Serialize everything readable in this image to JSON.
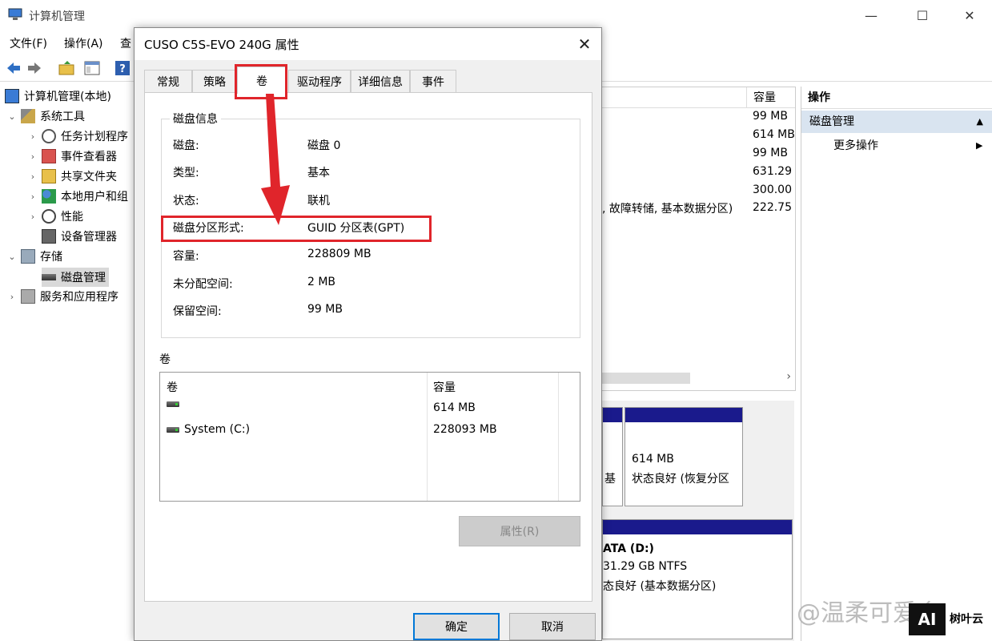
{
  "window": {
    "title": "计算机管理"
  },
  "menu": [
    "文件(F)",
    "操作(A)",
    "查"
  ],
  "tree": {
    "root": "计算机管理(本地)",
    "system_tools": "系统工具",
    "task_scheduler": "任务计划程序",
    "event_viewer": "事件查看器",
    "shared_folders": "共享文件夹",
    "local_users": "本地用户和组",
    "performance": "性能",
    "device_manager": "设备管理器",
    "storage": "存储",
    "disk_management": "磁盘管理",
    "services_apps": "服务和应用程序"
  },
  "list": {
    "capacity_header": "容量",
    "capacities": [
      "99 MB",
      "614 MB",
      "99 MB",
      "631.29",
      "300.00",
      "222.75"
    ],
    "partial_row_text": ", 故障转储, 基本数据分区)"
  },
  "graph": {
    "part1_label": "基",
    "part2_size": "614 MB",
    "part2_status": "状态良好 (恢复分区",
    "drive_d_name": "ATA  (D:)",
    "drive_d_size": "31.29 GB NTFS",
    "drive_d_status": "态良好 (基本数据分区)"
  },
  "actions": {
    "header": "操作",
    "selected": "磁盘管理",
    "more": "更多操作"
  },
  "dialog": {
    "title": "CUSO C5S-EVO 240G 属性",
    "tabs": [
      "常规",
      "策略",
      "卷",
      "驱动程序",
      "详细信息",
      "事件"
    ],
    "active_tab": "卷",
    "disk_info_title": "磁盘信息",
    "disk_info": [
      {
        "label": "磁盘:",
        "value": "磁盘 0"
      },
      {
        "label": "类型:",
        "value": "基本"
      },
      {
        "label": "状态:",
        "value": "联机"
      },
      {
        "label": "磁盘分区形式:",
        "value": "GUID 分区表(GPT)"
      },
      {
        "label": "容量:",
        "value": "228809 MB"
      },
      {
        "label": "未分配空间:",
        "value": "2 MB"
      },
      {
        "label": "保留空间:",
        "value": "99 MB"
      }
    ],
    "volumes_title": "卷",
    "volume_columns": [
      "卷",
      "容量"
    ],
    "volumes": [
      {
        "name": "",
        "capacity": "614 MB"
      },
      {
        "name": "System (C:)",
        "capacity": "228093 MB"
      }
    ],
    "properties_button": "属性(R)",
    "ok_button": "确定",
    "cancel_button": "取消"
  },
  "watermark": {
    "text": "@温柔可爱乡",
    "badge": "AI",
    "badge_label": "树叶云"
  },
  "colors": {
    "highlight": "#e0252b",
    "bar": "#1a1a8c",
    "accent": "#0078d7"
  }
}
